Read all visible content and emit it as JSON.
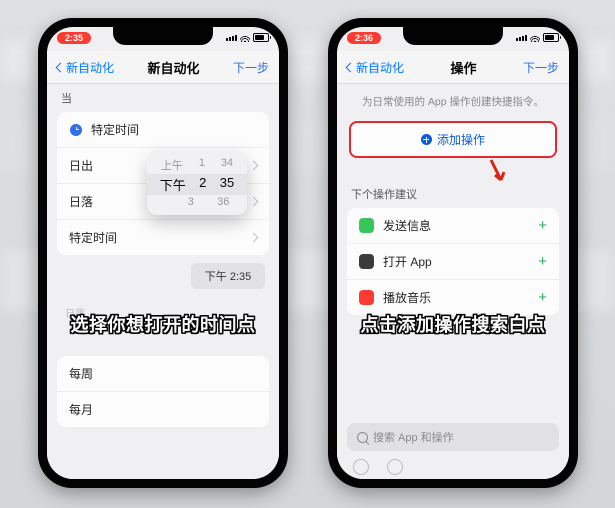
{
  "status": {
    "time_left": "2:35",
    "time_right": "2:36"
  },
  "nav": {
    "back": "新自动化",
    "title_left": "新自动化",
    "title_right": "操作",
    "next": "下一步"
  },
  "left": {
    "when_label": "当",
    "specific_time": "特定时间",
    "sunrise": "日出",
    "sunset": "日落",
    "specific_time2": "特定时间",
    "picker": {
      "r0": [
        "上午",
        "1",
        "34"
      ],
      "r1": [
        "下午",
        "2",
        "35"
      ],
      "r2": [
        "",
        "3",
        "36"
      ]
    },
    "chip": "下午 2:35",
    "muted": "日落",
    "weekly": "每周",
    "monthly": "每月"
  },
  "right": {
    "hint": "为日常使用的 App 操作创建快捷指令。",
    "add_action": "添加操作",
    "suggest_label": "下个操作建议",
    "suggestions": [
      {
        "label": "发送信息",
        "color": "#34c759"
      },
      {
        "label": "打开 App",
        "color": "#3a3a3c"
      },
      {
        "label": "播放音乐",
        "color": "#ff3b30"
      }
    ],
    "search_ph": "搜索 App 和操作"
  },
  "captions": {
    "left": "选择你想打开的时间点",
    "right": "点击添加操作搜索白点"
  }
}
